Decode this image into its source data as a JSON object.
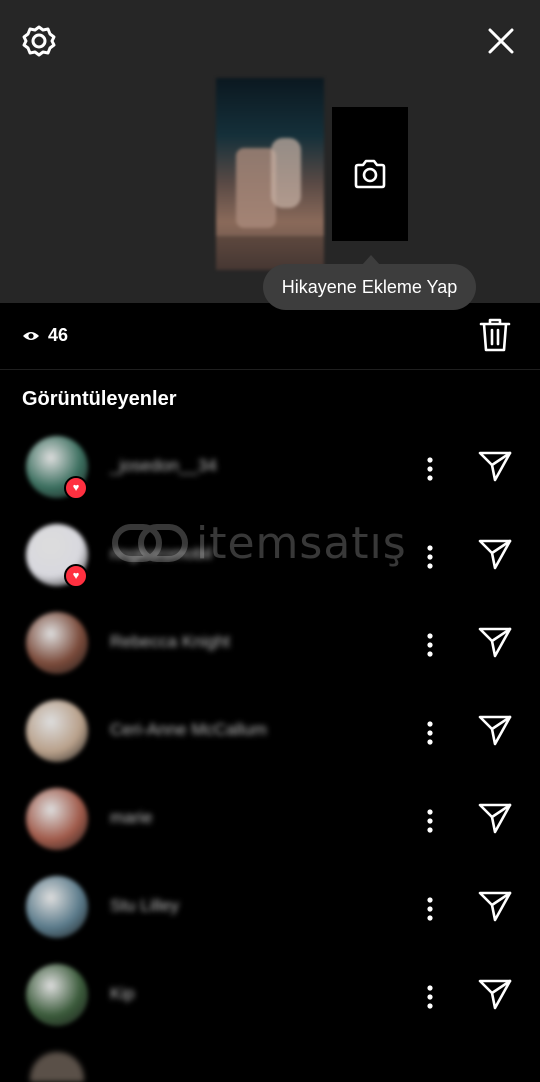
{
  "header": {
    "settings_icon": "gear-icon",
    "close_icon": "close-icon"
  },
  "story": {
    "add_icon": "camera-icon",
    "tooltip": "Hikayene Ekleme Yap"
  },
  "stats": {
    "eye_icon": "eye-icon",
    "views": "46",
    "delete_icon": "trash-icon"
  },
  "viewers": {
    "title": "Görüntüleyenler",
    "items": [
      {
        "username": "_josedon__34",
        "liked": true,
        "avatar_color": "#3a6e5e"
      },
      {
        "username": "ringkoromobil",
        "liked": true,
        "avatar_color": "#d8d8de"
      },
      {
        "username": "Rebecca Knight",
        "liked": false,
        "avatar_color": "#7a4a3a"
      },
      {
        "username": "Ceri-Anne McCallum",
        "liked": false,
        "avatar_color": "#b8a08a"
      },
      {
        "username": "marie",
        "liked": false,
        "avatar_color": "#a05a4a"
      },
      {
        "username": "Stu Lilley",
        "liked": false,
        "avatar_color": "#5a7a8a"
      },
      {
        "username": "Kip",
        "liked": false,
        "avatar_color": "#3a5a3a"
      }
    ]
  },
  "watermark": {
    "text": "itemsatış"
  },
  "colors": {
    "background": "#000000",
    "top_panel": "#262626",
    "tooltip": "#3d3d3d",
    "like": "#ff3040"
  }
}
